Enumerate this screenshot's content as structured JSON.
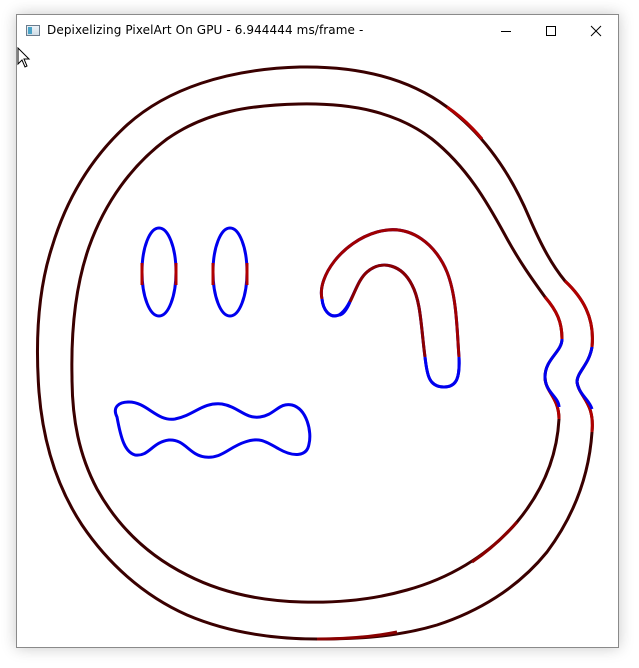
{
  "window": {
    "title": "Depixelizing PixelArt On GPU - 6.944444 ms/frame -"
  },
  "controls": {
    "minimize": "minimize",
    "maximize": "maximize",
    "close": "close"
  },
  "icons": {
    "app": "app-window-icon",
    "cursor": "mouse-pointer-icon"
  },
  "colors": {
    "outline_dark": "#3a0000",
    "outline_red": "#b00000",
    "feature_blue": "#0000ee"
  }
}
